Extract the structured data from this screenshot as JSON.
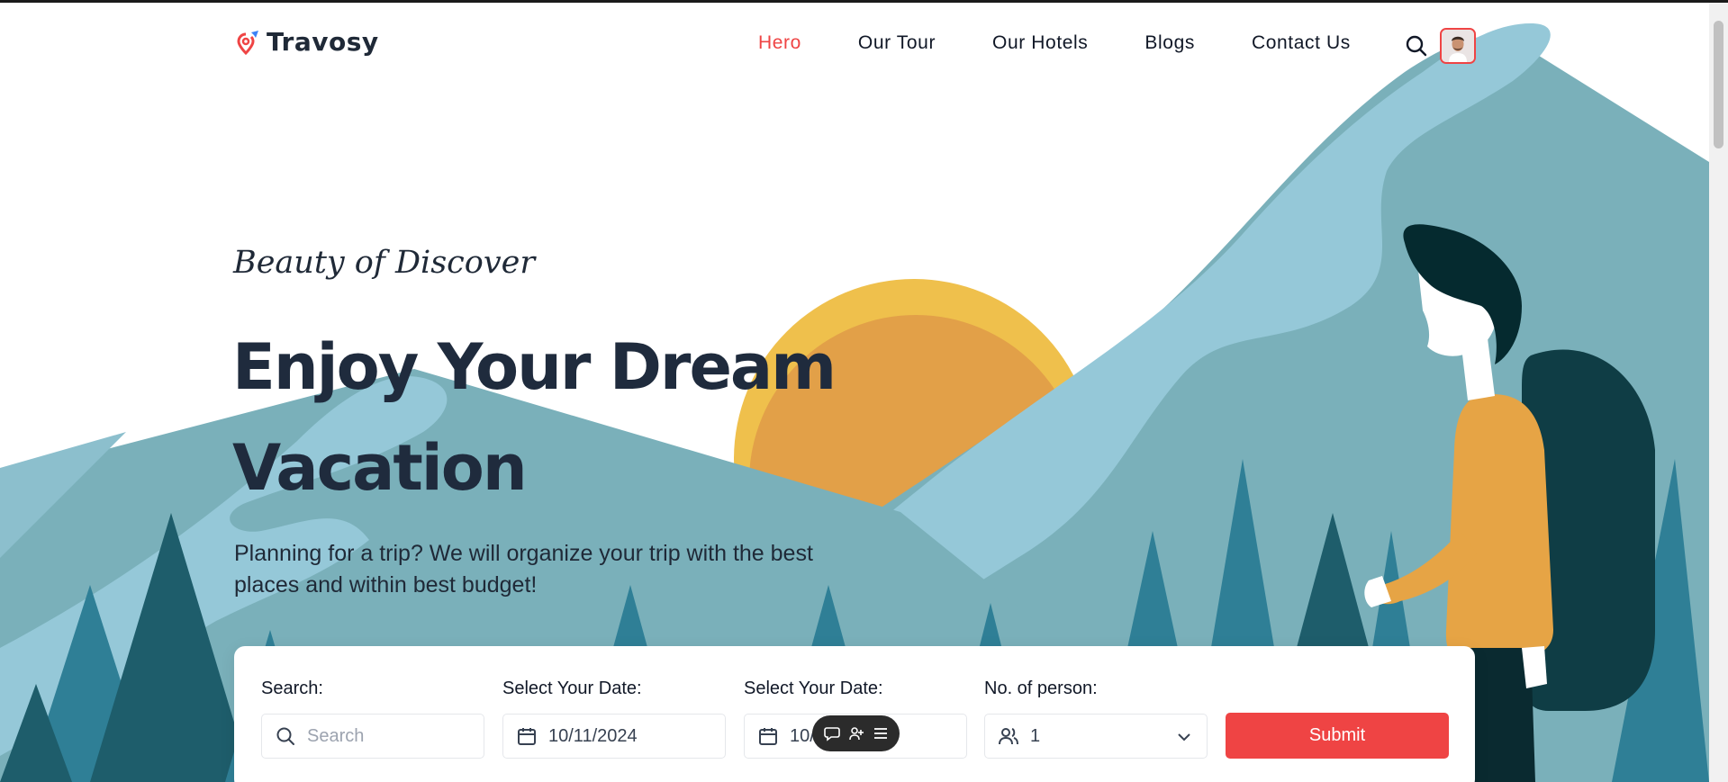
{
  "brand": {
    "name": "Travosy"
  },
  "nav": {
    "links": [
      "Hero",
      "Our Tour",
      "Our Hotels",
      "Blogs",
      "Contact Us"
    ],
    "active_index": 0
  },
  "hero": {
    "tagline": "Beauty of Discover",
    "headline": "Enjoy Your Dream Vacation",
    "subtext": "Planning for a trip? We will organize your trip with the best places and within best budget!"
  },
  "booking": {
    "search_label": "Search:",
    "search_placeholder": "Search",
    "date1_label": "Select Your Date:",
    "date1_value": "10/11/2024",
    "date2_label": "Select Your Date:",
    "date2_value": "10/",
    "persons_label": "No. of person:",
    "persons_value": "1",
    "submit_label": "Submit"
  },
  "icons": {
    "search": "search-icon",
    "calendar": "calendar-icon",
    "users": "users-icon",
    "chevron": "chevron-down-icon",
    "float_toolbar": [
      "comment-icon",
      "add-user-icon",
      "menu-icon"
    ]
  },
  "colors": {
    "accent": "#ef4444",
    "heading": "#1f2b3d",
    "sun_outer": "#efc04c",
    "sun_inner": "#e2a048",
    "mountain": "#7ab0ba",
    "mountain_light": "#95c8d8",
    "tree": "#2f7f96",
    "tree_dark": "#1e5d6b"
  }
}
